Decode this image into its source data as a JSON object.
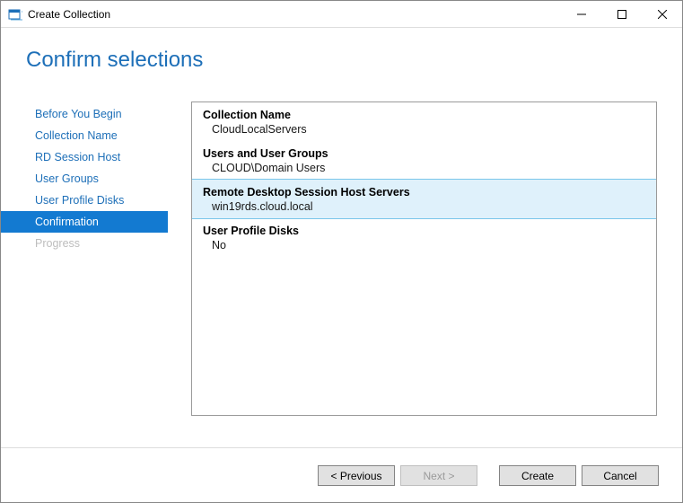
{
  "window": {
    "title": "Create Collection"
  },
  "header": {
    "title": "Confirm selections"
  },
  "sidebar": {
    "steps": [
      {
        "label": "Before You Begin",
        "state": "normal"
      },
      {
        "label": "Collection Name",
        "state": "normal"
      },
      {
        "label": "RD Session Host",
        "state": "normal"
      },
      {
        "label": "User Groups",
        "state": "normal"
      },
      {
        "label": "User Profile Disks",
        "state": "normal"
      },
      {
        "label": "Confirmation",
        "state": "active"
      },
      {
        "label": "Progress",
        "state": "disabled"
      }
    ]
  },
  "summary": {
    "sections": [
      {
        "label": "Collection Name",
        "value": "CloudLocalServers",
        "selected": false
      },
      {
        "label": "Users and User Groups",
        "value": "CLOUD\\Domain Users",
        "selected": false
      },
      {
        "label": "Remote Desktop Session Host Servers",
        "value": "win19rds.cloud.local",
        "selected": true
      },
      {
        "label": "User Profile Disks",
        "value": "No",
        "selected": false
      }
    ]
  },
  "footer": {
    "previous": "< Previous",
    "next": "Next >",
    "create": "Create",
    "cancel": "Cancel"
  }
}
